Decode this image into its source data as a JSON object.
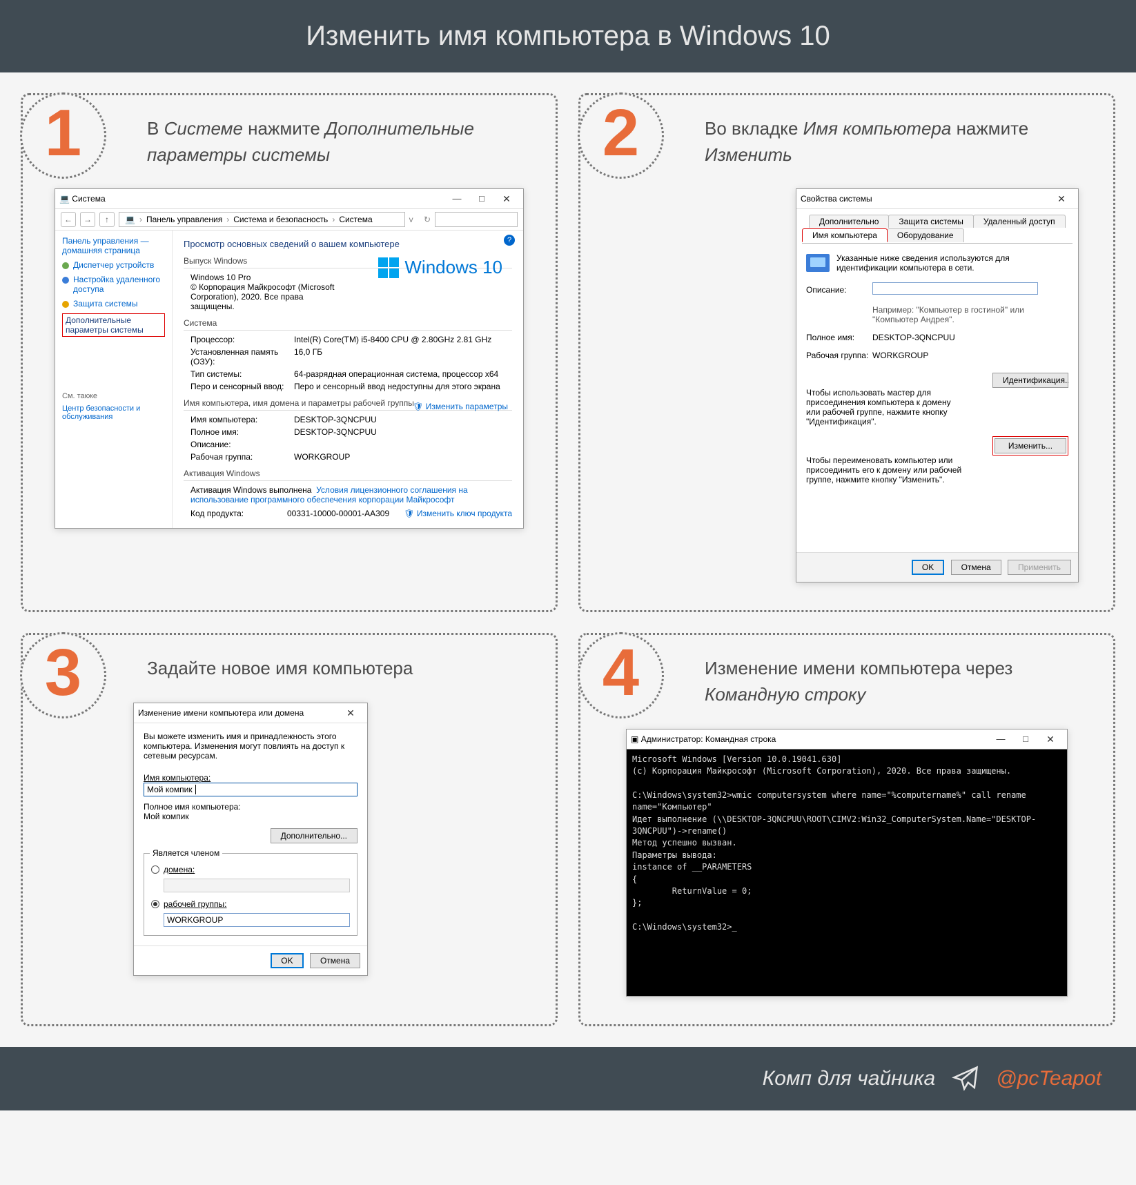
{
  "header": "Изменить имя компьютера в Windows 10",
  "steps": [
    {
      "num": "1",
      "caption_pre": "В ",
      "caption_em1": "Системе",
      "caption_mid": " нажмите ",
      "caption_em2": "Дополни­тельные параметры системы"
    },
    {
      "num": "2",
      "caption_pre": "Во вкладке ",
      "caption_em1": "Имя компьютера",
      "caption_mid": " нажмите ",
      "caption_em2": "Изменить"
    },
    {
      "num": "3",
      "caption_pre": "Задайте новое имя компьютера",
      "caption_em1": "",
      "caption_mid": "",
      "caption_em2": ""
    },
    {
      "num": "4",
      "caption_pre": "Изменение имени компьютера через ",
      "caption_em1": "Командную строку",
      "caption_mid": "",
      "caption_em2": ""
    }
  ],
  "panel1": {
    "title": "Система",
    "breadcrumb": [
      "Панель управления",
      "Система и безопасность",
      "Система"
    ],
    "side_home": "Панель управления — домашняя страница",
    "side_items": [
      "Диспетчер устройств",
      "Настройка удаленного доступа",
      "Защита системы"
    ],
    "side_hl": "Дополнительные параметры системы",
    "side_also": "См. также",
    "side_sec": "Центр безопасности и обслуживания",
    "h_view": "Просмотр основных сведений о вашем компьютере",
    "sec_ed": "Выпуск Windows",
    "ed_name": "Windows 10 Pro",
    "ed_copy": "© Корпорация Майкрософт (Microsoft Corporation), 2020. Все права защищены.",
    "logo": "Windows 10",
    "sec_sys": "Система",
    "kv_sys": [
      [
        "Процессор:",
        "Intel(R) Core(TM) i5-8400 CPU @ 2.80GHz   2.81 GHz"
      ],
      [
        "Установленная память (ОЗУ):",
        "16,0 ГБ"
      ],
      [
        "Тип системы:",
        "64-разрядная операционная система, процессор x64"
      ],
      [
        "Перо и сенсорный ввод:",
        "Перо и сенсорный ввод недоступны для этого экрана"
      ]
    ],
    "sec_dom": "Имя компьютера, имя домена и параметры рабочей группы",
    "kv_dom": [
      [
        "Имя компьютера:",
        "DESKTOP-3QNCPUU"
      ],
      [
        "Полное имя:",
        "DESKTOP-3QNCPUU"
      ],
      [
        "Описание:",
        ""
      ],
      [
        "Рабочая группа:",
        "WORKGROUP"
      ]
    ],
    "change_link": "Изменить параметры",
    "sec_act": "Активация Windows",
    "act_text": "Активация Windows выполнена",
    "act_link": "Условия лицензионного соглашения на использование программного обеспечения корпорации Майкрософт",
    "act_prod_l": "Код продукта:",
    "act_prod_v": "00331-10000-00001-AA309",
    "act_key": "Изменить ключ продукта"
  },
  "panel2": {
    "title": "Свойства системы",
    "tabs_top": [
      "Дополнительно",
      "Защита системы",
      "Удаленный доступ"
    ],
    "tabs_bot": [
      "Имя компьютера",
      "Оборудование"
    ],
    "info": "Указанные ниже сведения используются для идентификации компьютера в сети.",
    "desc_label": "Описание:",
    "desc_hint": "Например: \"Компьютер в гостиной\" или \"Компьютер Андрея\".",
    "full_label": "Полное имя:",
    "full_value": "DESKTOP-3QNCPUU",
    "wg_label": "Рабочая группа:",
    "wg_value": "WORKGROUP",
    "wiz_text": "Чтобы использовать мастер для присоединения компьютера к домену или рабочей группе, нажмите кнопку \"Идентификация\".",
    "btn_ident": "Идентификация...",
    "ren_text": "Чтобы переименовать компьютер или присоединить его к домену или рабочей группе, нажмите кнопку \"Изменить\".",
    "btn_change": "Изменить...",
    "ok": "OK",
    "cancel": "Отмена",
    "apply": "Применить"
  },
  "panel3": {
    "title": "Изменение имени компьютера или домена",
    "intro": "Вы можете изменить имя и принадлежность этого компьютера. Изменения могут повлиять на доступ к сетевым ресурсам.",
    "name_label": "Имя компьютера:",
    "name_value": "Мой компик",
    "full_label": "Полное имя компьютера:",
    "full_value": "Мой компик",
    "more": "Дополнительно...",
    "member": "Является членом",
    "r_domain": "домена:",
    "r_wg": "рабочей группы:",
    "wg_value": "WORKGROUP",
    "ok": "OK",
    "cancel": "Отмена"
  },
  "panel4": {
    "title": "Администратор: Командная строка",
    "lines": [
      "Microsoft Windows [Version 10.0.19041.630]",
      "(c) Корпорация Майкрософт (Microsoft Corporation), 2020. Все права защищены.",
      "",
      "C:\\Windows\\system32>wmic computersystem where name=\"%computername%\" call rename name=\"Компьютер\"",
      "Идет выполнение (\\\\DESKTOP-3QNCPUU\\ROOT\\CIMV2:Win32_ComputerSystem.Name=\"DESKTOP-3QNCPUU\")->rename()",
      "Метод успешно вызван.",
      "Параметры вывода:",
      "instance of __PARAMETERS",
      "{",
      "        ReturnValue = 0;",
      "};",
      "",
      "C:\\Windows\\system32>_"
    ]
  },
  "footer": {
    "brand": "Комп для чайника",
    "handle": "@pcTeapot"
  }
}
